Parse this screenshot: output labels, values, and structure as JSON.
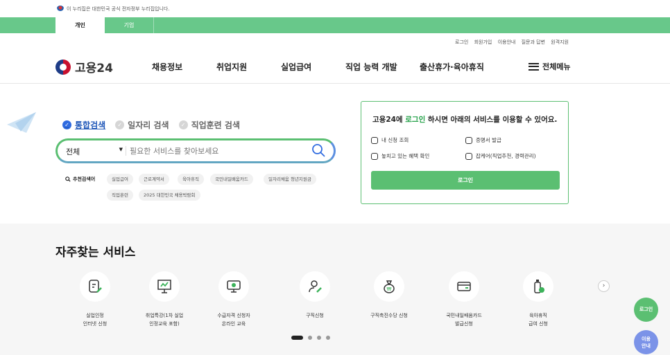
{
  "gov_banner": {
    "text": "이 누리집은 대한민국 공식 전자정부 누리집입니다."
  },
  "tabs": [
    {
      "label": "개인"
    },
    {
      "label": "기업"
    }
  ],
  "util_links": [
    "로그인",
    "회원가입",
    "이용안내",
    "질문과 답변",
    "원격지원"
  ],
  "logo": {
    "name": "고용24"
  },
  "gnb": [
    "채용정보",
    "취업지원",
    "실업급여",
    "직업 능력 개발",
    "출산휴가·육아휴직"
  ],
  "menu_all": "전체메뉴",
  "search_types": [
    "통합검색",
    "일자리 검색",
    "직업훈련 검색"
  ],
  "search": {
    "category": "전체",
    "placeholder": "필요한 서비스를 찾아보세요"
  },
  "recommended": {
    "label": "추천검색어",
    "keywords": [
      "실업급여",
      "근로계약서",
      "육아휴직",
      "국민내일배움카드",
      "일자리채움 청년지원금",
      "직업훈련",
      "2025 대한민국 채용박람회"
    ]
  },
  "login_card": {
    "title_pre": "고용24에 ",
    "title_link": "로그인",
    "title_post": " 하시면 아래의 서비스를 이용할 수 있어요.",
    "services": [
      "내 신청 조회",
      "증명서 발급",
      "놓치고 있는 혜택 확인",
      "잡케어(직업추천, 경력관리)"
    ],
    "button": "로그인"
  },
  "favorites": {
    "title": "자주찾는 서비스",
    "items": [
      {
        "l1": "실업인정",
        "l2": "인터넷 신청",
        "icon": "document-pen-icon"
      },
      {
        "l1": "취업특강(1차 실업",
        "l2": "인정교육 포함)",
        "icon": "lecture-board-icon"
      },
      {
        "l1": "수급자격 신청자",
        "l2": "온라인 교육",
        "icon": "monitor-icon"
      },
      {
        "l1": "구직신청",
        "l2": "",
        "icon": "person-pen-icon"
      },
      {
        "l1": "구직촉진수당 신청",
        "l2": "",
        "icon": "money-bag-icon"
      },
      {
        "l1": "국민내일배움카드",
        "l2": "발급신청",
        "icon": "card-icon"
      },
      {
        "l1": "육아휴직",
        "l2": "급여 신청",
        "icon": "baby-bottle-icon"
      }
    ]
  },
  "floating": {
    "login": "로그인",
    "guide_l1": "이용",
    "guide_l2": "안내"
  },
  "colors": {
    "green": "#5bbf72",
    "blue": "#2f6be0",
    "accent_text": "#22a047"
  }
}
